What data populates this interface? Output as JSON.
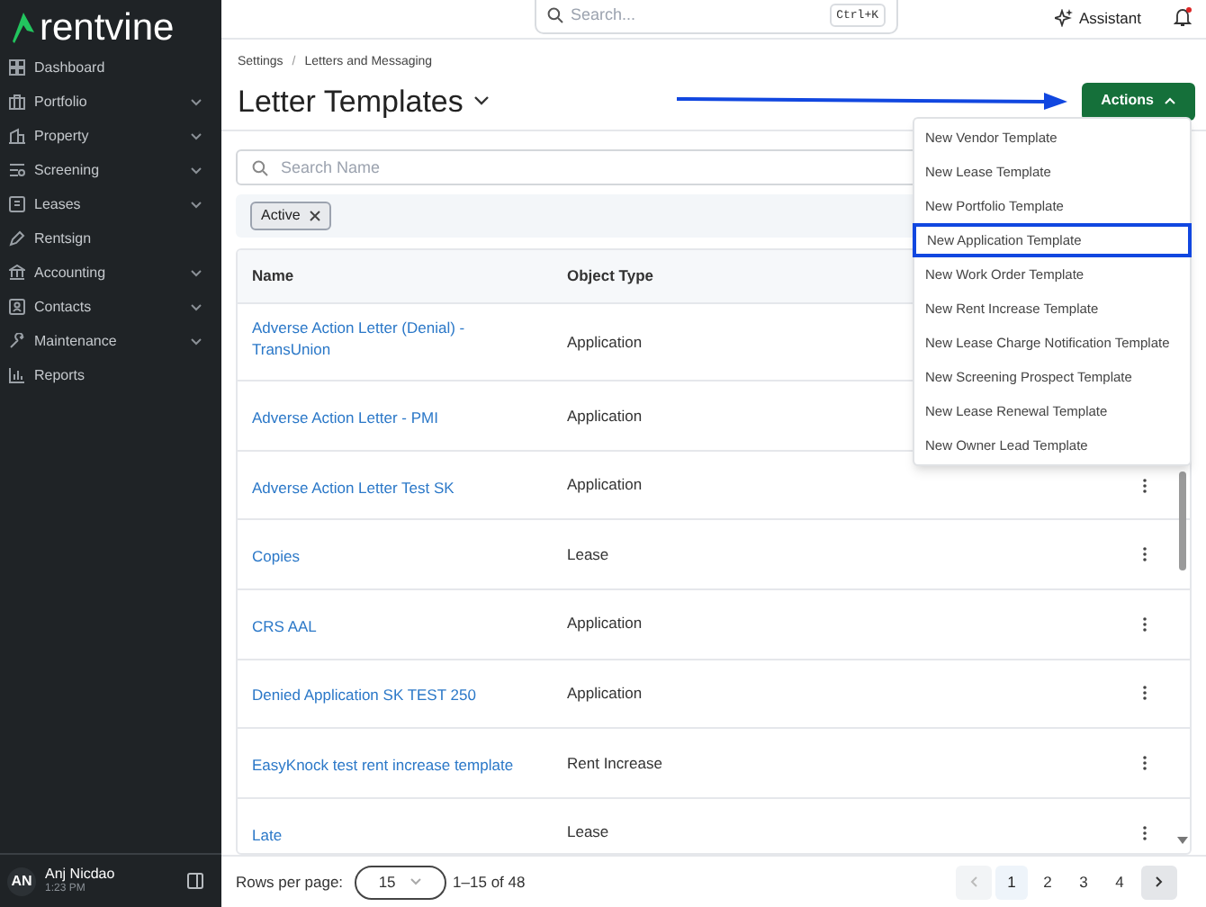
{
  "sidebar": {
    "logo": "rentvine",
    "items": [
      {
        "label": "Dashboard",
        "kind": "grid",
        "expandable": false
      },
      {
        "label": "Portfolio",
        "kind": "briefcase",
        "expandable": true
      },
      {
        "label": "Property",
        "kind": "building",
        "expandable": true
      },
      {
        "label": "Screening",
        "kind": "list",
        "expandable": true
      },
      {
        "label": "Leases",
        "kind": "doc",
        "expandable": true
      },
      {
        "label": "Rentsign",
        "kind": "pen",
        "expandable": false
      },
      {
        "label": "Accounting",
        "kind": "bank",
        "expandable": true
      },
      {
        "label": "Contacts",
        "kind": "contact",
        "expandable": true
      },
      {
        "label": "Maintenance",
        "kind": "wrench",
        "expandable": true
      },
      {
        "label": "Reports",
        "kind": "chart",
        "expandable": false
      }
    ],
    "user": {
      "initials": "AN",
      "name": "Anj Nicdao",
      "time": "1:23 PM"
    }
  },
  "top_bar": {
    "search": {
      "placeholder": "Search...",
      "shortcut": "Ctrl+K"
    },
    "assistant": "Assistant",
    "notification_dot": true
  },
  "breadcrumb": {
    "items": [
      "Settings",
      "Letters and Messaging"
    ],
    "separator": "/"
  },
  "title": "Letter Templates",
  "actions_button": {
    "label": "Actions",
    "expanded": true
  },
  "actions_menu": [
    {
      "label": "New Vendor Template",
      "selected": false
    },
    {
      "label": "New Lease Template",
      "selected": false
    },
    {
      "label": "New Portfolio Template",
      "selected": false
    },
    {
      "label": "New Application Template",
      "selected": true
    },
    {
      "label": "New Work Order Template",
      "selected": false
    },
    {
      "label": "New Rent Increase Template",
      "selected": false
    },
    {
      "label": "New Lease Charge Notification Template",
      "selected": false
    },
    {
      "label": "New Screening Prospect Template",
      "selected": false
    },
    {
      "label": "New Lease Renewal Template",
      "selected": false
    },
    {
      "label": "New Owner Lead Template",
      "selected": false
    }
  ],
  "search_name": {
    "placeholder": "Search Name"
  },
  "filters": [
    {
      "label": "Active"
    }
  ],
  "table": {
    "columns": [
      "Name",
      "Object Type"
    ],
    "rows": [
      {
        "name": "Adverse Action Letter (Denial) - TransUnion",
        "object_type": "Application"
      },
      {
        "name": "Adverse Action Letter - PMI",
        "object_type": "Application"
      },
      {
        "name": "Adverse Action Letter Test SK",
        "object_type": "Application"
      },
      {
        "name": "Copies",
        "object_type": "Lease"
      },
      {
        "name": "CRS AAL",
        "object_type": "Application"
      },
      {
        "name": "Denied Application SK TEST 250",
        "object_type": "Application"
      },
      {
        "name": "EasyKnock test rent increase template",
        "object_type": "Rent Increase"
      },
      {
        "name": "Late",
        "object_type": "Lease"
      }
    ]
  },
  "footer": {
    "rows_per_page_label": "Rows per page:",
    "rows_per_page": "15",
    "range": "1–15 of 48",
    "pages": [
      {
        "label": "1",
        "selected": true
      },
      {
        "label": "2",
        "selected": false
      },
      {
        "label": "3",
        "selected": false
      },
      {
        "label": "4",
        "selected": false
      }
    ]
  }
}
